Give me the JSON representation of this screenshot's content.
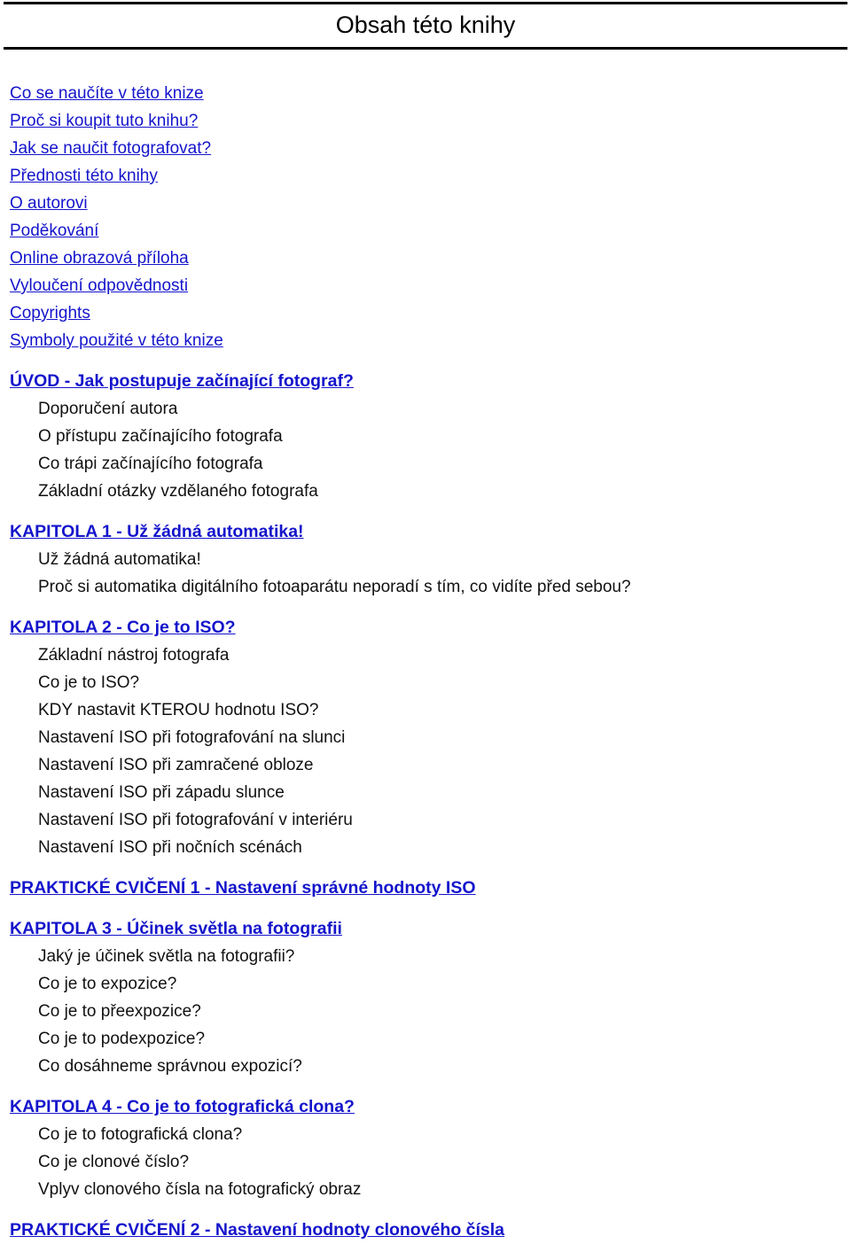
{
  "document": {
    "title": "Obsah této knihy",
    "language": "cs",
    "link_color": "#1414CC",
    "text_color": "#111111",
    "rule_color": "#000000",
    "background_color": "#FFFFFF"
  },
  "toc": {
    "entries": [
      {
        "type": "link",
        "text": "Co se naučíte v této knize"
      },
      {
        "type": "link",
        "text": "Proč si koupit tuto knihu?"
      },
      {
        "type": "link",
        "text": "Jak se naučit fotografovat?"
      },
      {
        "type": "link",
        "text": "Přednosti této knihy"
      },
      {
        "type": "link",
        "text": "O autorovi"
      },
      {
        "type": "link",
        "text": "Poděkování"
      },
      {
        "type": "link",
        "text": "Online obrazová příloha"
      },
      {
        "type": "link",
        "text": "Vyloučení odpovědnosti"
      },
      {
        "type": "link",
        "text": "Copyrights"
      },
      {
        "type": "link",
        "text": "Symboly použité v této knize"
      },
      {
        "type": "heading",
        "text": "ÚVOD - Jak postupuje začínající fotograf?"
      },
      {
        "type": "sub",
        "text": "Doporučení autora"
      },
      {
        "type": "sub",
        "text": "O přístupu začínajícího fotografa"
      },
      {
        "type": "sub",
        "text": "Co trápi začínajícího fotografa"
      },
      {
        "type": "sub",
        "text": "Základní otázky vzdělaného fotografa"
      },
      {
        "type": "heading",
        "text": "KAPITOLA 1 - Už žádná automatika!"
      },
      {
        "type": "sub",
        "text": "Už žádná automatika!"
      },
      {
        "type": "sub",
        "text": "Proč si automatika digitálního fotoaparátu neporadí s tím, co vidíte před sebou?"
      },
      {
        "type": "heading",
        "text": "KAPITOLA 2 - Co je to ISO?"
      },
      {
        "type": "sub",
        "text": "Základní nástroj fotografa"
      },
      {
        "type": "sub",
        "text": "Co je to ISO?"
      },
      {
        "type": "sub",
        "text": "KDY nastavit KTEROU hodnotu ISO?"
      },
      {
        "type": "sub",
        "text": "Nastavení ISO při fotografování na slunci"
      },
      {
        "type": "sub",
        "text": "Nastavení ISO při zamračené obloze"
      },
      {
        "type": "sub",
        "text": "Nastavení ISO při západu slunce"
      },
      {
        "type": "sub",
        "text": "Nastavení ISO při fotografování v interiéru"
      },
      {
        "type": "sub",
        "text": "Nastavení ISO při nočních scénách"
      },
      {
        "type": "heading",
        "text": "PRAKTICKÉ CVIČENÍ 1 - Nastavení správné hodnoty ISO"
      },
      {
        "type": "heading",
        "text": "KAPITOLA 3 - Účinek světla na fotografii"
      },
      {
        "type": "sub",
        "text": "Jaký je účinek světla na fotografii?"
      },
      {
        "type": "sub",
        "text": "Co je to expozice?"
      },
      {
        "type": "sub",
        "text": "Co je to přeexpozice?"
      },
      {
        "type": "sub",
        "text": "Co je to podexpozice?"
      },
      {
        "type": "sub",
        "text": "Co dosáhneme správnou expozicí?"
      },
      {
        "type": "heading",
        "text": "KAPITOLA 4 - Co je to fotografická clona?"
      },
      {
        "type": "sub",
        "text": "Co je to fotografická clona?"
      },
      {
        "type": "sub",
        "text": "Co je clonové číslo?"
      },
      {
        "type": "sub",
        "text": "Vplyv clonového čísla na fotografický obraz"
      },
      {
        "type": "heading",
        "text": "PRAKTICKÉ CVIČENÍ 2 - Nastavení hodnoty clonového čísla"
      }
    ]
  }
}
